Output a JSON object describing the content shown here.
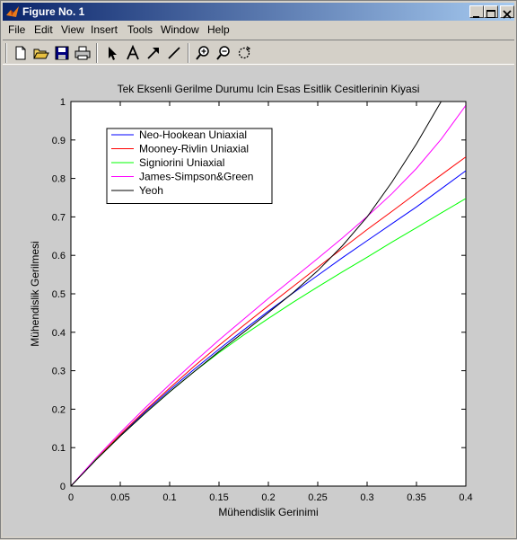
{
  "window": {
    "title": "Figure No. 1",
    "controls": [
      "minimize-icon",
      "maximize-icon",
      "close-icon"
    ]
  },
  "menu": {
    "file": "File",
    "edit": "Edit",
    "view": "View",
    "insert": "Insert",
    "tools": "Tools",
    "window": "Window",
    "help": "Help"
  },
  "toolbar": {
    "icons": [
      "new-file-icon",
      "open-folder-icon",
      "save-icon",
      "print-icon",
      "select-arrow-icon",
      "insert-text-icon",
      "insert-arrow-icon",
      "insert-line-icon",
      "zoom-in-icon",
      "zoom-out-icon",
      "rotate-icon"
    ]
  },
  "chart_data": {
    "type": "line",
    "title": "Tek Eksenli Gerilme Durumu Icin Esas Esitlik Cesitlerinin Kiyasi",
    "xlabel": "Mühendislik Gerinimi",
    "ylabel": "Mühendislik Gerilmesi",
    "xlim": [
      0,
      0.4
    ],
    "ylim": [
      0,
      1
    ],
    "xticks": [
      0,
      0.05,
      0.1,
      0.15,
      0.2,
      0.25,
      0.3,
      0.35,
      0.4
    ],
    "xticklabels": [
      "0",
      "0.05",
      "0.1",
      "0.15",
      "0.2",
      "0.25",
      "0.3",
      "0.35",
      "0.4"
    ],
    "yticks": [
      0,
      0.1,
      0.2,
      0.3,
      0.4,
      0.5,
      0.6,
      0.7,
      0.8,
      0.9,
      1
    ],
    "yticklabels": [
      "0",
      "0.1",
      "0.2",
      "0.3",
      "0.4",
      "0.5",
      "0.6",
      "0.7",
      "0.8",
      "0.9",
      "1"
    ],
    "grid": false,
    "legend_position": "top-left",
    "x": [
      0,
      0.025,
      0.05,
      0.075,
      0.1,
      0.125,
      0.15,
      0.175,
      0.2,
      0.225,
      0.25,
      0.275,
      0.3,
      0.325,
      0.35,
      0.375,
      0.4
    ],
    "series": [
      {
        "name": "Neo-Hookean Uniaxial",
        "color": "#0000ff",
        "values": [
          0,
          0.068,
          0.132,
          0.193,
          0.25,
          0.304,
          0.356,
          0.406,
          0.455,
          0.502,
          0.548,
          0.594,
          0.638,
          0.682,
          0.726,
          0.773,
          0.82
        ]
      },
      {
        "name": "Mooney-Rivlin Uniaxial",
        "color": "#ff0000",
        "values": [
          0,
          0.069,
          0.134,
          0.196,
          0.255,
          0.312,
          0.366,
          0.418,
          0.469,
          0.519,
          0.569,
          0.618,
          0.667,
          0.714,
          0.762,
          0.809,
          0.856
        ]
      },
      {
        "name": "Signiorini Uniaxial",
        "color": "#00ff00",
        "values": [
          0,
          0.068,
          0.13,
          0.189,
          0.245,
          0.298,
          0.347,
          0.393,
          0.436,
          0.478,
          0.518,
          0.557,
          0.595,
          0.634,
          0.672,
          0.71,
          0.748
        ]
      },
      {
        "name": "James-Simpson&Green",
        "color": "#ff00ff",
        "values": [
          0,
          0.072,
          0.139,
          0.203,
          0.264,
          0.323,
          0.38,
          0.434,
          0.488,
          0.54,
          0.592,
          0.645,
          0.701,
          0.76,
          0.826,
          0.902,
          0.99
        ]
      },
      {
        "name": "Yeoh",
        "color": "#000000",
        "values": [
          0,
          0.067,
          0.13,
          0.189,
          0.245,
          0.298,
          0.35,
          0.4,
          0.451,
          0.503,
          0.56,
          0.625,
          0.7,
          0.79,
          0.89,
          1.0,
          null
        ]
      }
    ]
  }
}
